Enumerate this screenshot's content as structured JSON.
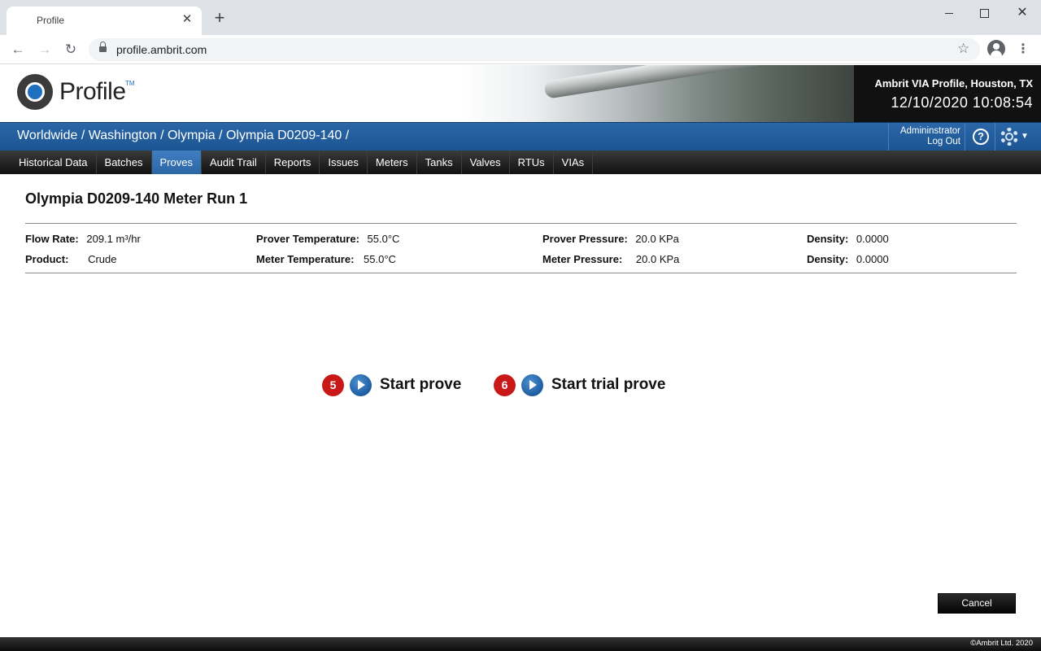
{
  "browser": {
    "tab_title": "Profile",
    "tab_close": "✕",
    "new_tab": "+",
    "url": "profile.ambrit.com",
    "icons": [
      "back-arrow-icon",
      "forward-arrow-icon",
      "reload-icon",
      "lock-icon",
      "star-icon",
      "account-icon",
      "more-menu-icon"
    ]
  },
  "header": {
    "logo_text": "Profile",
    "logo_tm": "TM",
    "site_name": "Ambrit VIA Profile, Houston, TX",
    "datetime": "12/10/2020 10:08:54"
  },
  "bluebar": {
    "breadcrumb": "Worldwide / Washington / Olympia / Olympia D0209-140 /",
    "user": "Admininstrator",
    "logout": "Log Out",
    "help": "?"
  },
  "menu": {
    "items": [
      {
        "label": "Historical Data"
      },
      {
        "label": "Batches"
      },
      {
        "label": "Proves"
      },
      {
        "label": "Audit Trail"
      },
      {
        "label": "Reports"
      },
      {
        "label": "Issues"
      },
      {
        "label": "Meters"
      },
      {
        "label": "Tanks"
      },
      {
        "label": "Valves"
      },
      {
        "label": "RTUs"
      },
      {
        "label": "VIAs"
      }
    ],
    "active": "Proves"
  },
  "page": {
    "title": "Olympia D0209-140 Meter Run 1",
    "flow_rate": {
      "label": "Flow Rate:",
      "value": "209.1 m³/hr"
    },
    "product": {
      "label": "Product:",
      "value": "Crude"
    },
    "prover_temperature": {
      "label": "Prover Temperature:",
      "value": "55.0°C"
    },
    "meter_temperature": {
      "label": "Meter Temperature:",
      "value": "55.0°C"
    },
    "prover_pressure": {
      "label": "Prover Pressure:",
      "value": "20.0 KPa"
    },
    "meter_pressure": {
      "label": "Meter Pressure:",
      "value": "20.0 KPa"
    },
    "density_1": {
      "label": "Density:",
      "value": "0.0000"
    },
    "density_2": {
      "label": "Density:",
      "value": "0.0000"
    }
  },
  "actions": {
    "start_prove": {
      "step": "5",
      "label": "Start prove"
    },
    "start_trial_prove": {
      "step": "6",
      "label": "Start trial prove"
    }
  },
  "buttons": {
    "cancel": "Cancel"
  },
  "footer": {
    "copyright": "©Ambrit Ltd. 2020"
  },
  "colors": {
    "brand_blue": "#1c5592",
    "active_tab": "#2b66a5",
    "step_badge": "#c81818"
  }
}
